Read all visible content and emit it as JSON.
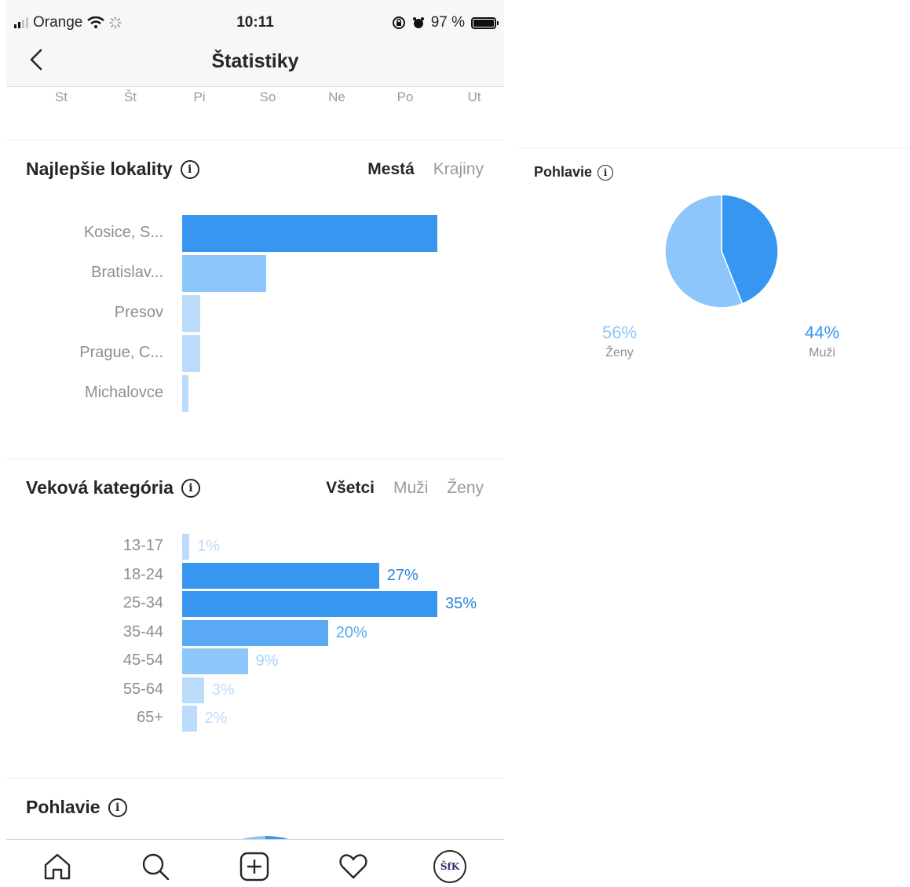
{
  "status_bar": {
    "carrier": "Orange",
    "time": "10:11",
    "battery": "97 %"
  },
  "nav": {
    "title": "Štatistiky"
  },
  "days": [
    "St",
    "Št",
    "Pi",
    "So",
    "Ne",
    "Po",
    "Ut"
  ],
  "locations": {
    "title": "Najlepšie lokality",
    "tabs": {
      "cities": "Mestá",
      "countries": "Krajiny"
    },
    "chart_data": {
      "type": "bar",
      "orientation": "horizontal",
      "categories": [
        "Kosice, S...",
        "Bratislav...",
        "Presov",
        "Prague, C...",
        "Michalovce"
      ],
      "values": [
        100,
        33,
        7,
        7,
        2
      ],
      "note": "no numeric labels shown; values are relative bar lengths"
    }
  },
  "age": {
    "title": "Veková kategória",
    "tabs": {
      "all": "Všetci",
      "men": "Muži",
      "women": "Ženy"
    },
    "chart_data": {
      "type": "bar",
      "orientation": "horizontal",
      "categories": [
        "13-17",
        "18-24",
        "25-34",
        "35-44",
        "45-54",
        "55-64",
        "65+"
      ],
      "values": [
        1,
        27,
        35,
        20,
        9,
        3,
        2
      ],
      "labels": [
        "1%",
        "27%",
        "35%",
        "20%",
        "9%",
        "3%",
        "2%"
      ],
      "xlim": [
        0,
        35
      ]
    }
  },
  "gender_section": {
    "title": "Pohlavie"
  },
  "gender_panel": {
    "title": "Pohlavie",
    "chart_data": {
      "type": "pie",
      "categories": [
        "Ženy",
        "Muži"
      ],
      "values": [
        56,
        44
      ],
      "labels": [
        "56%",
        "44%"
      ],
      "colors": [
        "#8cc6fb",
        "#3797f0"
      ]
    }
  },
  "colors": {
    "dark_blue": "#3797f0",
    "mid_blue": "#5aa9f4",
    "light_blue": "#8cc6fb",
    "pale_blue": "#bcdcfc"
  },
  "tabbar": {
    "items": [
      "home-icon",
      "search-icon",
      "add-post-icon",
      "heart-icon",
      "profile-avatar"
    ],
    "avatar_text": "ŠfK"
  }
}
